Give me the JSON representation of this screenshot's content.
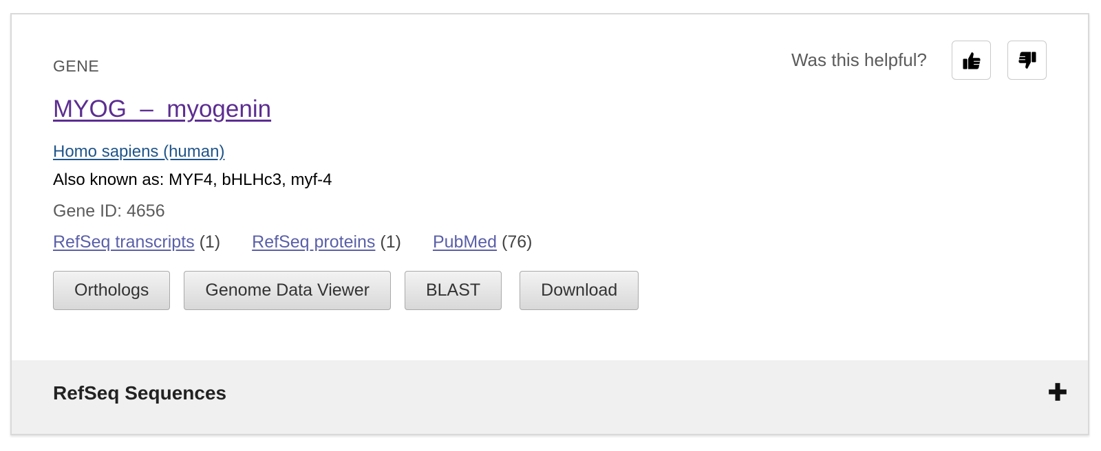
{
  "card": {
    "type_label": "GENE",
    "feedback": {
      "question": "Was this helpful?",
      "up_icon": "thumbs-up-icon",
      "down_icon": "thumbs-down-icon"
    },
    "title": "MYOG  –  myogenin",
    "organism": "Homo sapiens (human)",
    "also_known_as": "Also known as: MYF4, bHLHc3, myf-4",
    "gene_id": "Gene ID: 4656",
    "links": [
      {
        "label": "RefSeq transcripts",
        "count": "(1)"
      },
      {
        "label": "RefSeq proteins",
        "count": "(1)"
      },
      {
        "label": "PubMed",
        "count": "(76)"
      }
    ],
    "buttons": [
      "Orthologs",
      "Genome Data Viewer",
      "BLAST",
      "Download"
    ]
  },
  "section": {
    "title": "RefSeq Sequences",
    "toggle_icon": "plus-icon"
  },
  "colors": {
    "title_link": "#5c2d91",
    "organism_link": "#20558a",
    "resource_link": "#5a5fa8",
    "section_bg": "#f0f0f0"
  }
}
